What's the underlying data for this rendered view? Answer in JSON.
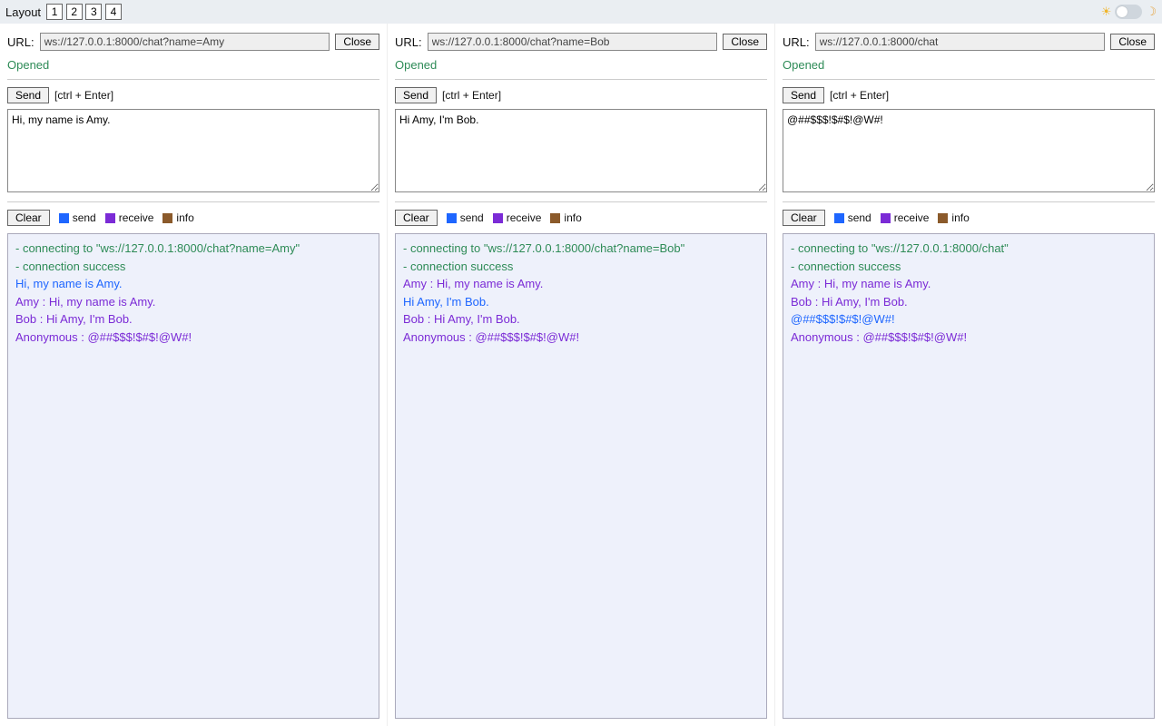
{
  "topbar": {
    "layout_label": "Layout",
    "layout_options": [
      "1",
      "2",
      "3",
      "4"
    ]
  },
  "labels": {
    "url": "URL:",
    "close": "Close",
    "send": "Send",
    "hint": "[ctrl + Enter]",
    "clear": "Clear",
    "legend_send": "send",
    "legend_receive": "receive",
    "legend_info": "info",
    "opened": "Opened"
  },
  "panels": [
    {
      "url": "ws://127.0.0.1:8000/chat?name=Amy",
      "status": "Opened",
      "message": "Hi, my name is Amy.",
      "log": [
        {
          "type": "info",
          "text": "- connecting to \"ws://127.0.0.1:8000/chat?name=Amy\""
        },
        {
          "type": "info",
          "text": "- connection success"
        },
        {
          "type": "send",
          "text": "Hi, my name is Amy."
        },
        {
          "type": "recv",
          "text": "Amy : Hi, my name is Amy."
        },
        {
          "type": "recv",
          "text": "Bob : Hi Amy, I'm Bob."
        },
        {
          "type": "recv",
          "text": "Anonymous : @##$$$!$#$!@W#!"
        }
      ]
    },
    {
      "url": "ws://127.0.0.1:8000/chat?name=Bob",
      "status": "Opened",
      "message": "Hi Amy, I'm Bob.",
      "log": [
        {
          "type": "info",
          "text": "- connecting to \"ws://127.0.0.1:8000/chat?name=Bob\""
        },
        {
          "type": "info",
          "text": "- connection success"
        },
        {
          "type": "recv",
          "text": "Amy : Hi, my name is Amy."
        },
        {
          "type": "send",
          "text": "Hi Amy, I'm Bob."
        },
        {
          "type": "recv",
          "text": "Bob : Hi Amy, I'm Bob."
        },
        {
          "type": "recv",
          "text": "Anonymous : @##$$$!$#$!@W#!"
        }
      ]
    },
    {
      "url": "ws://127.0.0.1:8000/chat",
      "status": "Opened",
      "message": "@##$$$!$#$!@W#!",
      "log": [
        {
          "type": "info",
          "text": "- connecting to \"ws://127.0.0.1:8000/chat\""
        },
        {
          "type": "info",
          "text": "- connection success"
        },
        {
          "type": "recv",
          "text": "Amy : Hi, my name is Amy."
        },
        {
          "type": "recv",
          "text": "Bob : Hi Amy, I'm Bob."
        },
        {
          "type": "send",
          "text": "@##$$$!$#$!@W#!"
        },
        {
          "type": "recv",
          "text": "Anonymous : @##$$$!$#$!@W#!"
        }
      ]
    }
  ]
}
